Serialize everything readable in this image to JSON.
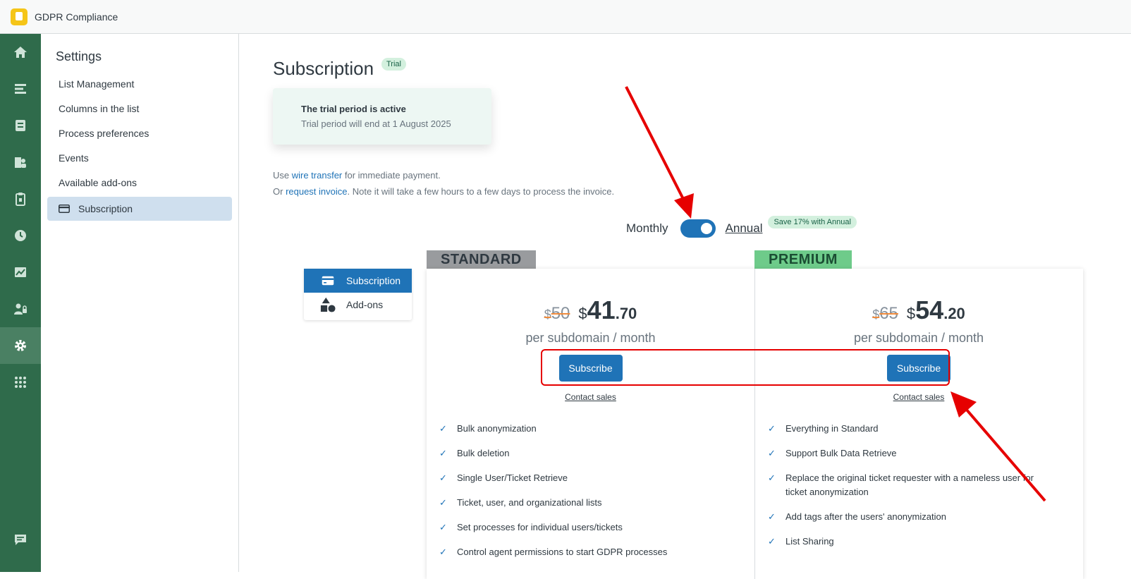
{
  "app": {
    "name": "GDPR Compliance"
  },
  "nav": {
    "icons": [
      "home-icon",
      "list-icon",
      "inbox-icon",
      "users-icon",
      "clipboard-icon",
      "clock-icon",
      "chart-icon",
      "user-lock-icon",
      "gear-icon",
      "apps-icon",
      "chat-icon"
    ],
    "active": "gear-icon"
  },
  "settings": {
    "title": "Settings",
    "items": [
      "List Management",
      "Columns in the list",
      "Process preferences",
      "Events",
      "Available add-ons",
      "Subscription"
    ],
    "active": "Subscription"
  },
  "page": {
    "title": "Subscription",
    "badge": "Trial"
  },
  "trial": {
    "heading": "The trial period is active",
    "subtext": "Trial period will end at 1 August 2025"
  },
  "payment": {
    "line1_prefix": "Use ",
    "line1_link": "wire transfer",
    "line1_suffix": " for immediate payment.",
    "line2_prefix": "Or ",
    "line2_link": "request invoice",
    "line2_suffix": ". Note it will take a few hours to a few days to process the invoice."
  },
  "billing_toggle": {
    "monthly": "Monthly",
    "annual": "Annual",
    "selected": "Annual",
    "save_badge": "Save 17% with Annual"
  },
  "side_tabs": [
    {
      "label": "Subscription",
      "icon": "card-icon",
      "active": true
    },
    {
      "label": "Add-ons",
      "icon": "shapes-icon",
      "active": false
    }
  ],
  "plans": [
    {
      "tag": "STANDARD",
      "old_price_currency": "$",
      "old_price": "50",
      "currency": "$",
      "price_whole": "41",
      "price_decimal": ".70",
      "per": "per subdomain / month",
      "cta": "Subscribe",
      "contact": "Contact sales",
      "features": [
        "Bulk anonymization",
        "Bulk deletion",
        "Single User/Ticket Retrieve",
        "Ticket, user, and organizational lists",
        "Set processes for individual users/tickets",
        "Control agent permissions to start GDPR processes"
      ]
    },
    {
      "tag": "PREMIUM",
      "old_price_currency": "$",
      "old_price": "65",
      "currency": "$",
      "price_whole": "54",
      "price_decimal": ".20",
      "per": "per subdomain / month",
      "cta": "Subscribe",
      "contact": "Contact sales",
      "features": [
        "Everything in Standard",
        "Support Bulk Data Retrieve",
        "Replace the original ticket requester with a nameless user for ticket anonymization",
        "Add tags after the users' anonymization",
        "List Sharing"
      ]
    }
  ],
  "colors": {
    "nav_bg": "#2f6b4b",
    "primary": "#1f73b7",
    "annotation": "#e60000",
    "premium_tag": "#6ecb8a",
    "standard_tag": "#999b9e"
  }
}
